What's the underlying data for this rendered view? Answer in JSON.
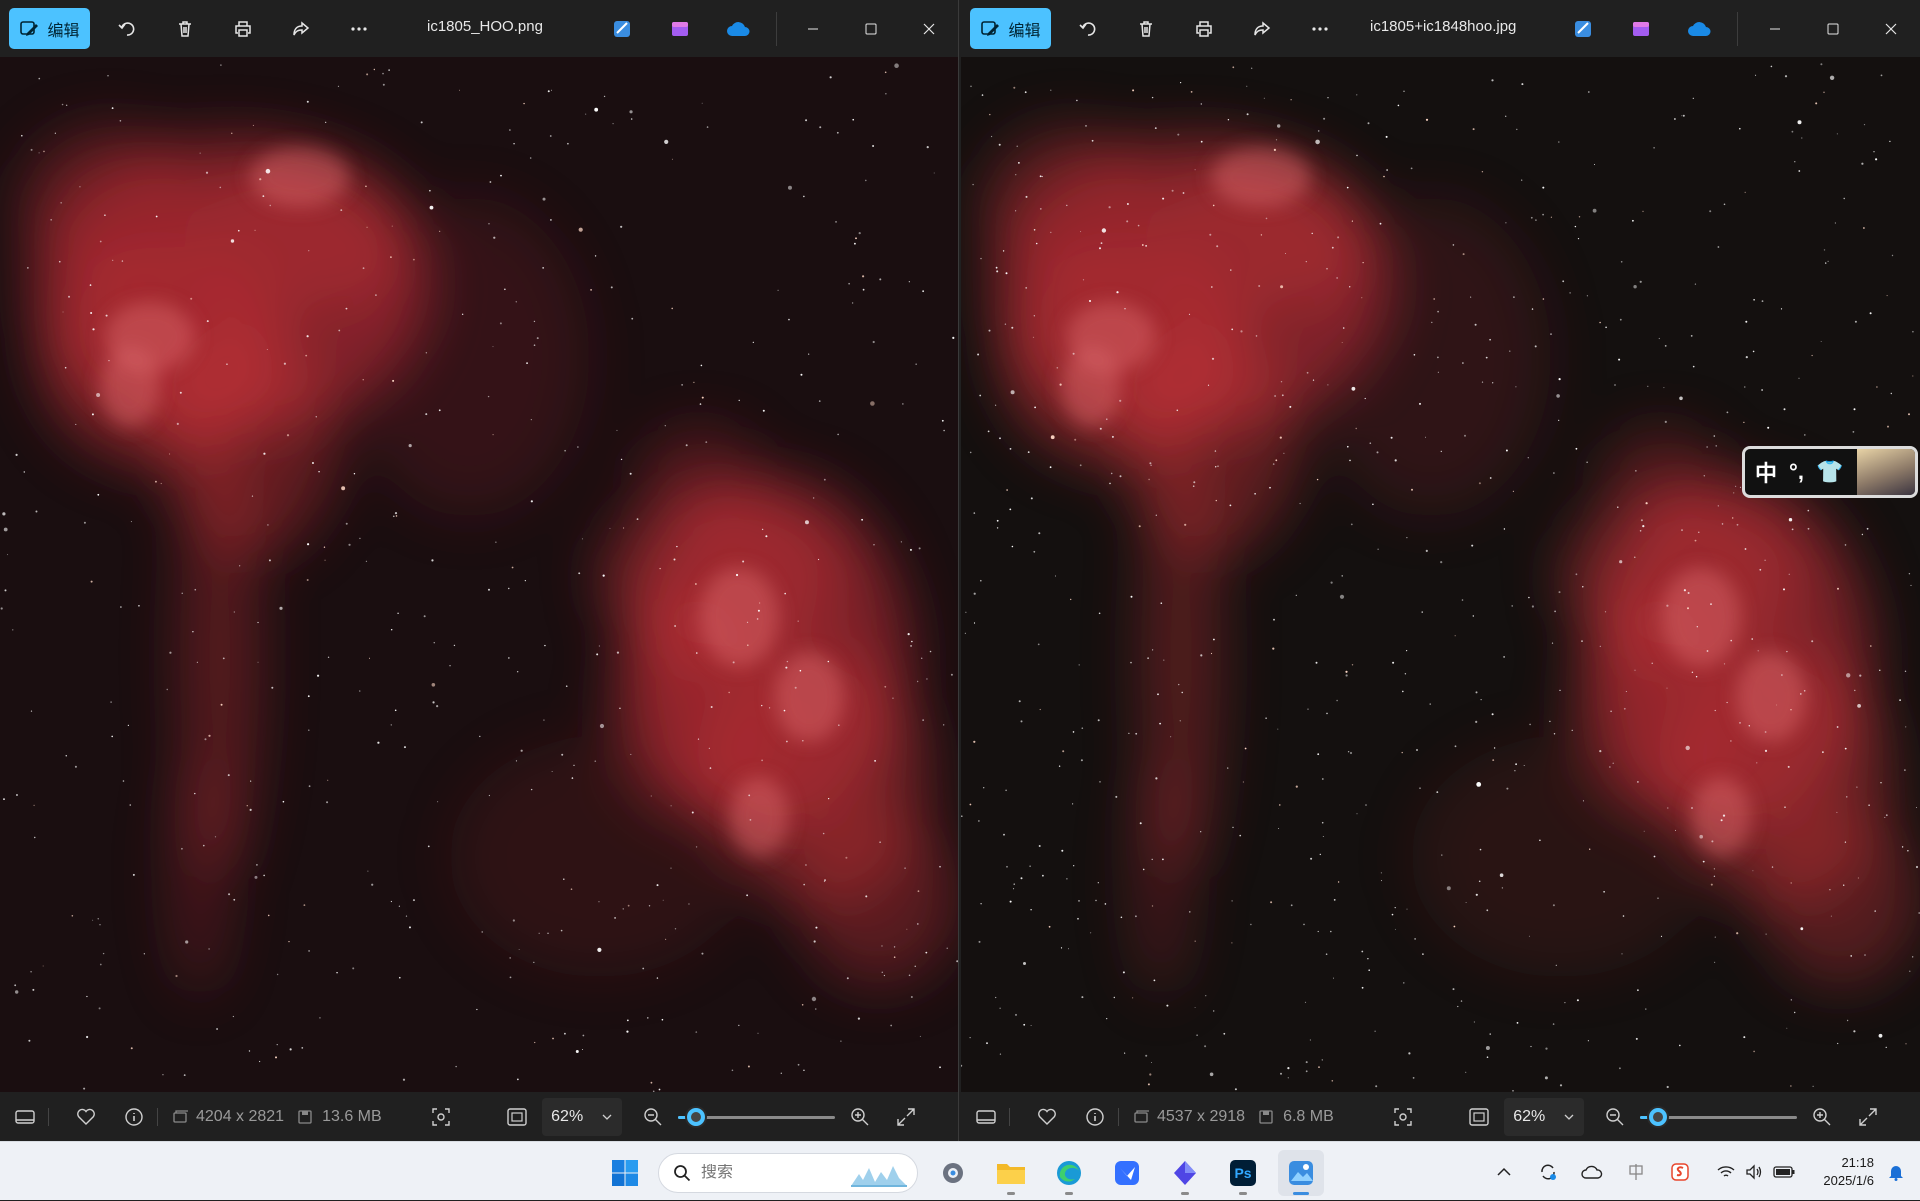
{
  "windows": {
    "left": {
      "edit_label": "编辑",
      "filename": "ic1805_HOO.png",
      "dimensions": "4204 x 2821",
      "filesize": "13.6 MB",
      "zoom": "62%",
      "zoom_level": 0.1
    },
    "right": {
      "edit_label": "编辑",
      "filename": "ic1805+ic1848hoo.jpg",
      "dimensions": "4537 x 2918",
      "filesize": "6.8 MB",
      "zoom": "62%",
      "zoom_level": 0.1
    }
  },
  "ime": {
    "mode": "中",
    "punct": "°,",
    "shirt": "👕"
  },
  "taskbar": {
    "search_placeholder": "搜索",
    "clock_time": "21:18",
    "clock_date": "2025/1/6",
    "apps": [
      "settings",
      "file-explorer",
      "edge",
      "feishu",
      "gem-app",
      "photoshop",
      "photos"
    ],
    "photoshop_label": "Ps"
  },
  "colors": {
    "accent": "#4cc2ff",
    "nebula": "#c8323a",
    "background": "#140c0d"
  }
}
